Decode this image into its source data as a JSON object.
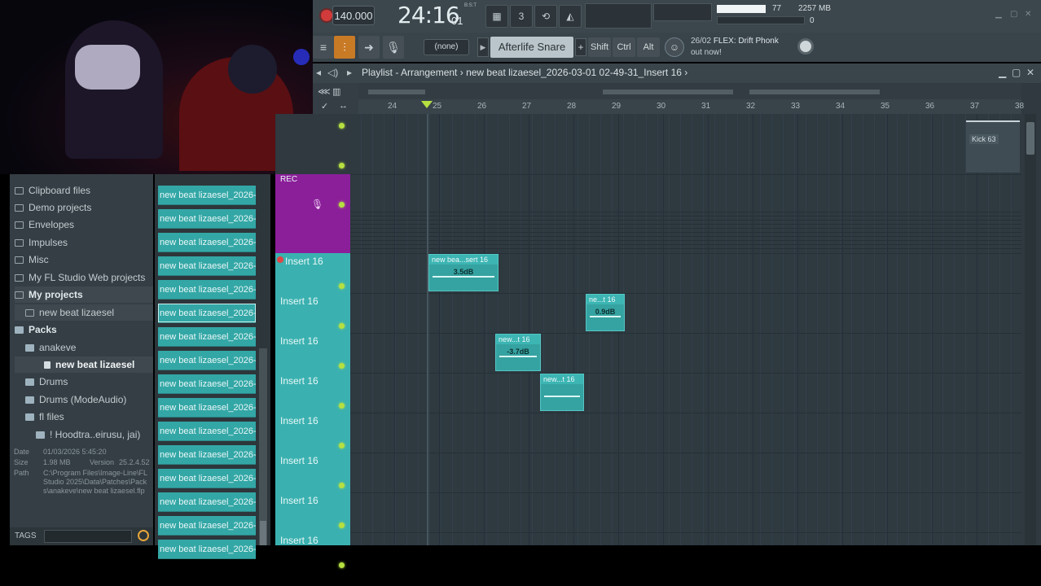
{
  "toolbar": {
    "tempo": "140.000",
    "time": "24:16",
    "time_ticks": "01",
    "time_unit": "B:S:T",
    "cpu": "77",
    "memory": "2257 MB",
    "polyphony": "0",
    "snap": "(none)",
    "pattern": "Afterlife Snare",
    "pattern_add": "+",
    "shift": "Shift",
    "ctrl": "Ctrl",
    "alt": "Alt",
    "news_line1_date": "26/02",
    "news_line1_text": "FLEX: Drift Phonk",
    "news_line2": "out now!"
  },
  "browser": {
    "items": [
      {
        "label": "Clipboard files"
      },
      {
        "label": "Demo projects"
      },
      {
        "label": "Envelopes"
      },
      {
        "label": "Impulses"
      },
      {
        "label": "Misc"
      },
      {
        "label": "My FL Studio Web projects"
      },
      {
        "label": "My projects"
      },
      {
        "label": "new beat lizaesel"
      },
      {
        "label": "Packs"
      },
      {
        "label": "anakeve"
      },
      {
        "label": "new beat lizaesel"
      },
      {
        "label": "Drums"
      },
      {
        "label": "Drums (ModeAudio)"
      },
      {
        "label": "fl files"
      },
      {
        "label": "! Hoodtra..eirusu, jai)"
      }
    ],
    "info": {
      "date_label": "Date",
      "date": "01/03/2026 5:45:20",
      "size_label": "Size",
      "size": "1.98 MB",
      "version_label": "Version",
      "version": "25.2.4.52",
      "path_label": "Path",
      "path": "C:\\Program Files\\Image-Line\\FL Studio 2025\\Data\\Patches\\Packs\\anakeve\\new beat lizaesel.flp"
    },
    "tags_label": "TAGS"
  },
  "files": {
    "cells": [
      "new beat lizaesel_2026-",
      "new beat lizaesel_2026-",
      "new beat lizaesel_2026-",
      "new beat lizaesel_2026-",
      "new beat lizaesel_2026-",
      "new beat lizaesel_2026-",
      "new beat lizaesel_2026-",
      "new beat lizaesel_2026-",
      "new beat lizaesel_2026-",
      "new beat lizaesel_2026-",
      "new beat lizaesel_2026-",
      "new beat lizaesel_2026-",
      "new beat lizaesel_2026-",
      "new beat lizaesel_2026-",
      "new beat lizaesel_2026-",
      "new beat lizaesel_2026-"
    ]
  },
  "playlist": {
    "title_prefix": "Playlist - Arrangement",
    "title_sep": "›",
    "title_name": "new beat lizaesel_2026-03-01 02-49-31_Insert 16",
    "bars": [
      "24",
      "25",
      "26",
      "27",
      "28",
      "29",
      "30",
      "31",
      "32",
      "33",
      "34",
      "35",
      "36",
      "37",
      "38"
    ],
    "tracks": {
      "rec": "REC",
      "insert_first": "Insert 16",
      "insert": "Insert 16"
    },
    "clips": [
      {
        "label": "new bea...sert 16",
        "gain": "3.5dB"
      },
      {
        "label": "ne...t 16",
        "gain": "0.9dB"
      },
      {
        "label": "new...t 16",
        "gain": "-3.7dB"
      },
      {
        "label": "new...t 16",
        "gain": ""
      }
    ],
    "kick": "Kick 63"
  }
}
